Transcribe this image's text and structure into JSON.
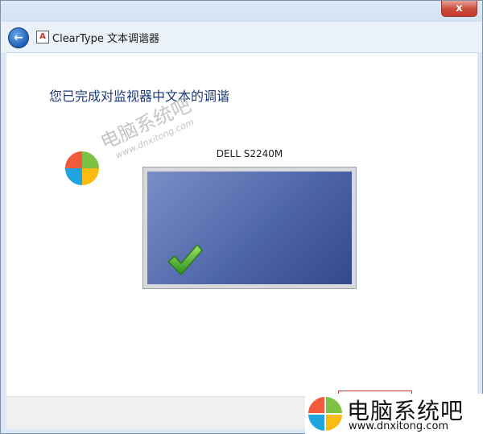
{
  "window": {
    "close_glyph": "x",
    "title": "ClearType 文本调谐器",
    "back_icon": "back-arrow-icon",
    "app_icon_glyph": "A"
  },
  "main": {
    "heading": "您已完成对监视器中文本的调谐",
    "monitor_label": "DELL S2240M",
    "check_icon": "green-checkmark-icon"
  },
  "watermark": {
    "small_cn": "电脑系统吧",
    "small_url": "www.dnxitong.com",
    "badge_cn": "电脑系统吧",
    "badge_url": "www.dnxitong.com"
  },
  "colors": {
    "heading": "#1e3a78",
    "monitor_screen": "#4e66a9",
    "check": "#4caf2f",
    "close": "#c53a2a"
  }
}
